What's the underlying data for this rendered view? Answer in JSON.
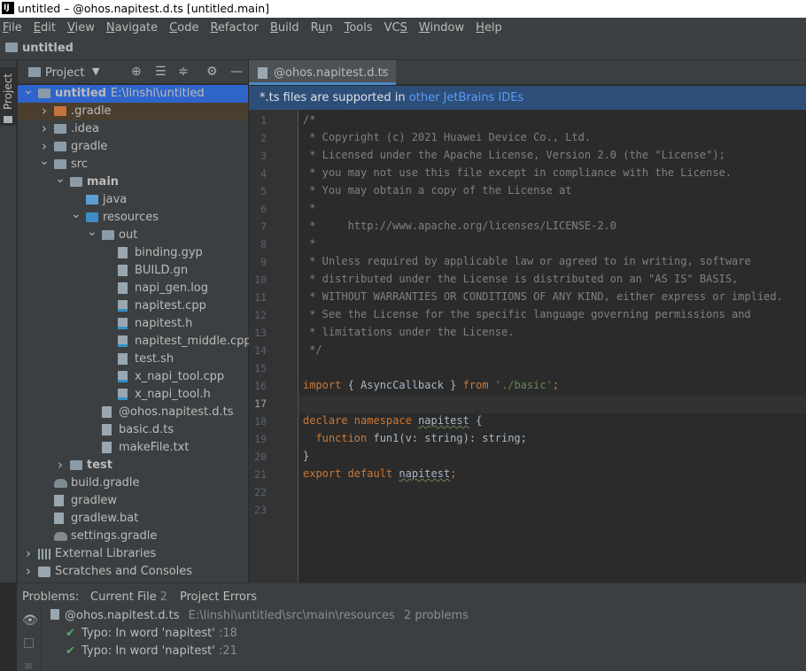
{
  "window": {
    "title": "untitled – @ohos.napitest.d.ts [untitled.main]",
    "logo": "IJ"
  },
  "menu": [
    "File",
    "Edit",
    "View",
    "Navigate",
    "Code",
    "Refactor",
    "Build",
    "Run",
    "Tools",
    "VCS",
    "Window",
    "Help"
  ],
  "menu_underline": [
    "F",
    "E",
    "V",
    "N",
    "C",
    "R",
    "B",
    "u",
    "T",
    "S",
    "W",
    "H"
  ],
  "navbar": {
    "project": "untitled"
  },
  "stripe": {
    "tab": "Project"
  },
  "project_panel": {
    "title": "Project"
  },
  "tree": [
    {
      "label": "untitled",
      "extra": "E:\\linshi\\untitled",
      "depth": 0,
      "arrow": "down",
      "icon": "folder-icon",
      "bold": true,
      "selected": true
    },
    {
      "label": ".gradle",
      "depth": 1,
      "arrow": "right",
      "icon": "folder-orange-icon",
      "highlight": true
    },
    {
      "label": ".idea",
      "depth": 1,
      "arrow": "right",
      "icon": "folder-icon"
    },
    {
      "label": "gradle",
      "depth": 1,
      "arrow": "right",
      "icon": "folder-icon"
    },
    {
      "label": "src",
      "depth": 1,
      "arrow": "down",
      "icon": "folder-icon"
    },
    {
      "label": "main",
      "depth": 2,
      "arrow": "down",
      "icon": "folder-icon",
      "bold": true
    },
    {
      "label": "java",
      "depth": 3,
      "arrow": "",
      "icon": "folder-blue-icon"
    },
    {
      "label": "resources",
      "depth": 3,
      "arrow": "down",
      "icon": "folder-dblue-icon"
    },
    {
      "label": "out",
      "depth": 4,
      "arrow": "down",
      "icon": "folder-icon"
    },
    {
      "label": "binding.gyp",
      "depth": 5,
      "arrow": "",
      "icon": "file-icon"
    },
    {
      "label": "BUILD.gn",
      "depth": 5,
      "arrow": "",
      "icon": "file-icon"
    },
    {
      "label": "napi_gen.log",
      "depth": 5,
      "arrow": "",
      "icon": "file-icon"
    },
    {
      "label": "napitest.cpp",
      "depth": 5,
      "arrow": "",
      "icon": "cpp-file-icon"
    },
    {
      "label": "napitest.h",
      "depth": 5,
      "arrow": "",
      "icon": "cpp-file-icon"
    },
    {
      "label": "napitest_middle.cpp",
      "depth": 5,
      "arrow": "",
      "icon": "cpp-file-icon"
    },
    {
      "label": "test.sh",
      "depth": 5,
      "arrow": "",
      "icon": "file-icon"
    },
    {
      "label": "x_napi_tool.cpp",
      "depth": 5,
      "arrow": "",
      "icon": "cpp-file-icon"
    },
    {
      "label": "x_napi_tool.h",
      "depth": 5,
      "arrow": "",
      "icon": "cpp-file-icon"
    },
    {
      "label": "@ohos.napitest.d.ts",
      "depth": 4,
      "arrow": "",
      "icon": "file-icon"
    },
    {
      "label": "basic.d.ts",
      "depth": 4,
      "arrow": "",
      "icon": "file-icon"
    },
    {
      "label": "makeFile.txt",
      "depth": 4,
      "arrow": "",
      "icon": "file-icon"
    },
    {
      "label": "test",
      "depth": 2,
      "arrow": "right",
      "icon": "folder-icon",
      "bold": true
    },
    {
      "label": "build.gradle",
      "depth": 1,
      "arrow": "",
      "icon": "gradle-icon"
    },
    {
      "label": "gradlew",
      "depth": 1,
      "arrow": "",
      "icon": "file-icon"
    },
    {
      "label": "gradlew.bat",
      "depth": 1,
      "arrow": "",
      "icon": "file-icon"
    },
    {
      "label": "settings.gradle",
      "depth": 1,
      "arrow": "",
      "icon": "gradle-icon"
    },
    {
      "label": "External Libraries",
      "depth": 0,
      "arrow": "right",
      "icon": "libraries-icon"
    },
    {
      "label": "Scratches and Consoles",
      "depth": 0,
      "arrow": "right",
      "icon": "scratches-icon"
    }
  ],
  "editor": {
    "tab": "@ohos.napitest.d.ts",
    "banner_prefix": "*.ts files are supported in ",
    "banner_link": "other JetBrains IDEs",
    "current_line": 17,
    "lines": [
      [
        {
          "t": "/*",
          "c": "cm"
        }
      ],
      [
        {
          "t": " * Copyright (c) 2021 Huawei Device Co., Ltd.",
          "c": "cm"
        }
      ],
      [
        {
          "t": " * Licensed under the Apache License, Version 2.0 (the \"License\");",
          "c": "cm"
        }
      ],
      [
        {
          "t": " * you may not use this file except in compliance with the License.",
          "c": "cm"
        }
      ],
      [
        {
          "t": " * You may obtain a copy of the License at",
          "c": "cm"
        }
      ],
      [
        {
          "t": " *",
          "c": "cm"
        }
      ],
      [
        {
          "t": " *     http://www.apache.org/licenses/LICENSE-2.0",
          "c": "cm"
        }
      ],
      [
        {
          "t": " *",
          "c": "cm"
        }
      ],
      [
        {
          "t": " * Unless required by applicable law or agreed to in writing, software",
          "c": "cm"
        }
      ],
      [
        {
          "t": " * distributed under the License is distributed on an \"AS IS\" BASIS,",
          "c": "cm"
        }
      ],
      [
        {
          "t": " * WITHOUT WARRANTIES OR CONDITIONS OF ANY KIND, either express or implied.",
          "c": "cm"
        }
      ],
      [
        {
          "t": " * See the License for the specific language governing permissions and",
          "c": "cm"
        }
      ],
      [
        {
          "t": " * limitations under the License.",
          "c": "cm"
        }
      ],
      [
        {
          "t": " */",
          "c": "cm"
        }
      ],
      [],
      [
        {
          "t": "import",
          "c": "kw"
        },
        {
          "t": " { AsyncCallback } ",
          "c": ""
        },
        {
          "t": "from",
          "c": "kw"
        },
        {
          "t": " ",
          "c": ""
        },
        {
          "t": "'./basic'",
          "c": "str"
        },
        {
          "t": ";",
          "c": "kw"
        }
      ],
      [],
      [
        {
          "t": "declare namespace",
          "c": "kw"
        },
        {
          "t": " ",
          "c": ""
        },
        {
          "t": "napitest",
          "c": "typo"
        },
        {
          "t": " {",
          "c": ""
        }
      ],
      [
        {
          "t": "  ",
          "c": ""
        },
        {
          "t": "function",
          "c": "kw"
        },
        {
          "t": " fun1(v: string): string;",
          "c": ""
        }
      ],
      [
        {
          "t": "}",
          "c": ""
        }
      ],
      [
        {
          "t": "export default",
          "c": "kw"
        },
        {
          "t": " ",
          "c": ""
        },
        {
          "t": "napitest",
          "c": "typo"
        },
        {
          "t": ";",
          "c": "kw"
        }
      ],
      [],
      []
    ]
  },
  "problems": {
    "label": "Problems:",
    "tabs": [
      {
        "label": "Current File",
        "count": "2"
      },
      {
        "label": "Project Errors",
        "count": ""
      }
    ],
    "file": "@ohos.napitest.d.ts",
    "path": "E:\\linshi\\untitled\\src\\main\\resources",
    "summary": "2 problems",
    "items": [
      {
        "text": "Typo: In word 'napitest'",
        "line": ":18"
      },
      {
        "text": "Typo: In word 'napitest'",
        "line": ":21"
      }
    ]
  }
}
